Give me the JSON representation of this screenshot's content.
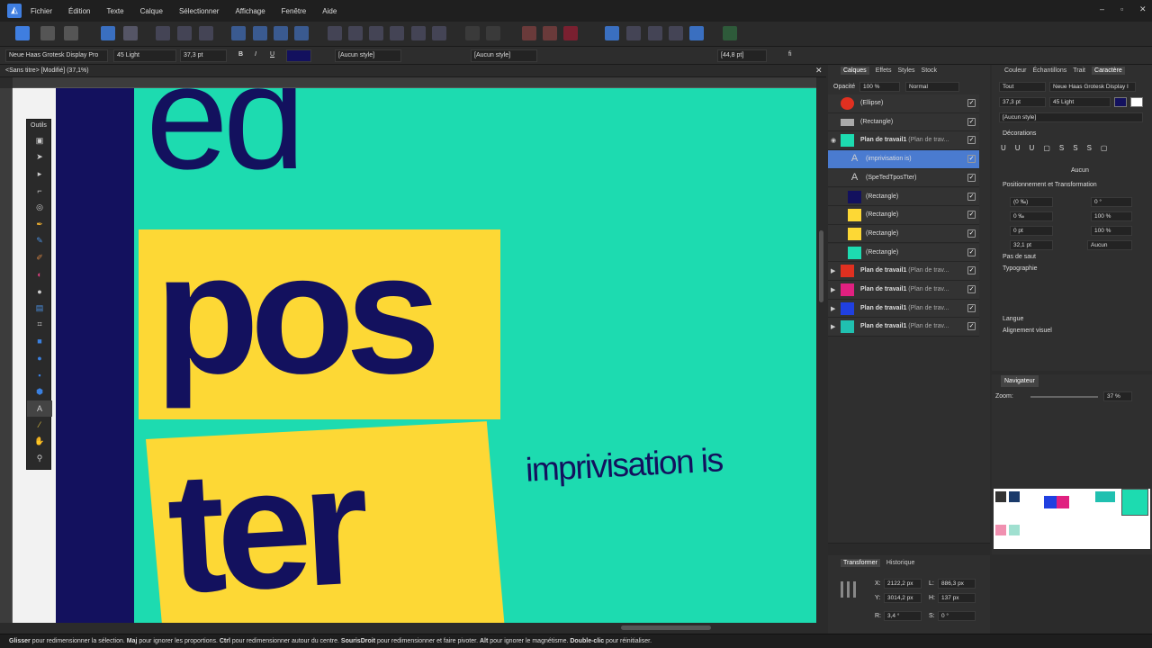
{
  "menu": [
    "Fichier",
    "Édition",
    "Texte",
    "Calque",
    "Sélectionner",
    "Affichage",
    "Fenêtre",
    "Aide"
  ],
  "window_controls": {
    "minimize": "–",
    "maximize": "▫",
    "close": "✕"
  },
  "ctx": {
    "font": "Neue Haas Grotesk Display Pro",
    "weight": "45 Light",
    "size": "37,3 pt",
    "bold": "B",
    "italic": "I",
    "underline": "U",
    "char_style": "[Aucun style]",
    "para_style": "[Aucun style]",
    "leading": "[44,8 pt]",
    "fi": "fi"
  },
  "doc_title": "<Sans titre> [Modifié] (37,1%)",
  "tools_title": "Outils",
  "canvas": {
    "word_ed": "ed",
    "word_pos": "pos",
    "word_ter": "ter",
    "improv": "imprivisation is",
    "colors": {
      "teal": "#1ddbb0",
      "navy": "#13115e",
      "yellow": "#fdd835"
    }
  },
  "layers_panel": {
    "tabs": [
      "Calques",
      "Effets",
      "Styles",
      "Stock"
    ],
    "opacity_label": "Opacité",
    "opacity_value": "100 %",
    "blend": "Normal",
    "items": [
      {
        "label": "(Ellipse)",
        "bold": false
      },
      {
        "label": "(Rectangle)",
        "bold": false
      },
      {
        "label": "Plan de travail1",
        "sub": "(Plan de trav...",
        "bold": true
      },
      {
        "label": "(imprivisation is)",
        "bold": false,
        "selected": true
      },
      {
        "label": "(SpeTedTposTter)",
        "bold": false
      },
      {
        "label": "(Rectangle)",
        "bold": false
      },
      {
        "label": "(Rectangle)",
        "bold": false
      },
      {
        "label": "(Rectangle)",
        "bold": false
      },
      {
        "label": "(Rectangle)",
        "bold": false
      },
      {
        "label": "Plan de travail1",
        "sub": "(Plan de trav...",
        "bold": true
      },
      {
        "label": "Plan de travail1",
        "sub": "(Plan de trav...",
        "bold": true
      },
      {
        "label": "Plan de travail1",
        "sub": "(Plan de trav...",
        "bold": true
      },
      {
        "label": "Plan de travail1",
        "sub": "(Plan de trav...",
        "bold": true
      }
    ]
  },
  "transform_panel": {
    "tabs": [
      "Transformer",
      "Historique"
    ],
    "x_label": "X:",
    "x": "2122,2 px",
    "y_label": "Y:",
    "y": "3014,2 px",
    "w_label": "L:",
    "w": "886,3 px",
    "h_label": "H:",
    "h": "137 px",
    "r_label": "R:",
    "r": "3,4 °",
    "s_label": "S:",
    "s": "0 °"
  },
  "char_panel": {
    "tabs": [
      "Couleur",
      "Échantillons",
      "Trait",
      "Caractère"
    ],
    "scope": "Tout",
    "font": "Neue Haas Grotesk Display I",
    "size": "37,3 pt",
    "weight": "45 Light",
    "style": "[Aucun style]",
    "decorations": "Décorations",
    "none": "Aucun",
    "pos_transform": "Positionnement et Transformation",
    "kern": "(0 ‰)",
    "track": "0 ‰",
    "baseline": "0 pt",
    "size2": "32,1 pt",
    "rot": "0 °",
    "hscale": "100 %",
    "vscale": "100 %",
    "skew": "Aucun",
    "no_break": "Pas de saut",
    "typography": "Typographie",
    "language": "Langue",
    "visual_align": "Alignement visuel"
  },
  "navigator": {
    "title": "Navigateur",
    "zoom_label": "Zoom:",
    "zoom": "37 %"
  },
  "status": {
    "segments": [
      {
        "t": "Glisser",
        "b": true
      },
      {
        "t": " pour redimensionner la sélection. ",
        "b": false
      },
      {
        "t": "Maj",
        "b": true
      },
      {
        "t": " pour ignorer les proportions. ",
        "b": false
      },
      {
        "t": "Ctrl",
        "b": true
      },
      {
        "t": " pour redimensionner autour du centre. ",
        "b": false
      },
      {
        "t": "SourisDroit",
        "b": true
      },
      {
        "t": " pour redimensionner et faire pivoter. ",
        "b": false
      },
      {
        "t": "Alt",
        "b": true
      },
      {
        "t": " pour ignorer le magnétisme. ",
        "b": false
      },
      {
        "t": "Double-clic",
        "b": true
      },
      {
        "t": " pour réinitialiser.",
        "b": false
      }
    ]
  }
}
